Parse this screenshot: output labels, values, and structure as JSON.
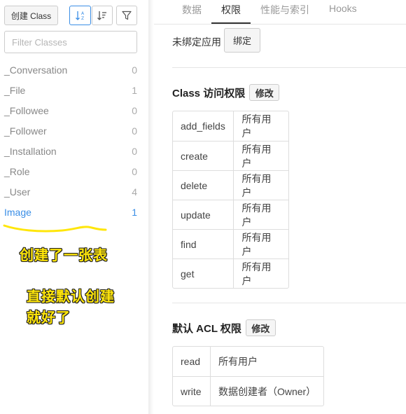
{
  "sidebar": {
    "create_button": "创建 Class",
    "sort_alpha_icon": "sort-alpha-icon",
    "sort_count_icon": "sort-count-icon",
    "filter_icon": "filter-icon",
    "filter_placeholder": "Filter Classes",
    "classes": [
      {
        "name": "_Conversation",
        "count": "0"
      },
      {
        "name": "_File",
        "count": "1"
      },
      {
        "name": "_Followee",
        "count": "0"
      },
      {
        "name": "_Follower",
        "count": "0"
      },
      {
        "name": "_Installation",
        "count": "0"
      },
      {
        "name": "_Role",
        "count": "0"
      },
      {
        "name": "_User",
        "count": "4"
      },
      {
        "name": "Image",
        "count": "1"
      }
    ],
    "active_color": "#3a8ee6"
  },
  "annotations": {
    "note1": "创建了一张表",
    "note2_line1": "直接默认创建",
    "note2_line2": "就好了",
    "color": "#ffe60a"
  },
  "tabs": [
    "数据",
    "权限",
    "性能与索引",
    "Hooks"
  ],
  "active_tab": "权限",
  "binding": {
    "label": "未绑定应用",
    "button": "绑定"
  },
  "class_permissions": {
    "title": "Class 访问权限",
    "modify": "修改",
    "rows": [
      {
        "key": "add_fields",
        "value": "所有用户"
      },
      {
        "key": "create",
        "value": "所有用户"
      },
      {
        "key": "delete",
        "value": "所有用户"
      },
      {
        "key": "update",
        "value": "所有用户"
      },
      {
        "key": "find",
        "value": "所有用户"
      },
      {
        "key": "get",
        "value": "所有用户"
      }
    ]
  },
  "acl_permissions": {
    "title": "默认 ACL 权限",
    "modify": "修改",
    "rows": [
      {
        "key": "read",
        "value": "所有用户"
      },
      {
        "key": "write",
        "value": "数据创建者（Owner）"
      }
    ]
  }
}
